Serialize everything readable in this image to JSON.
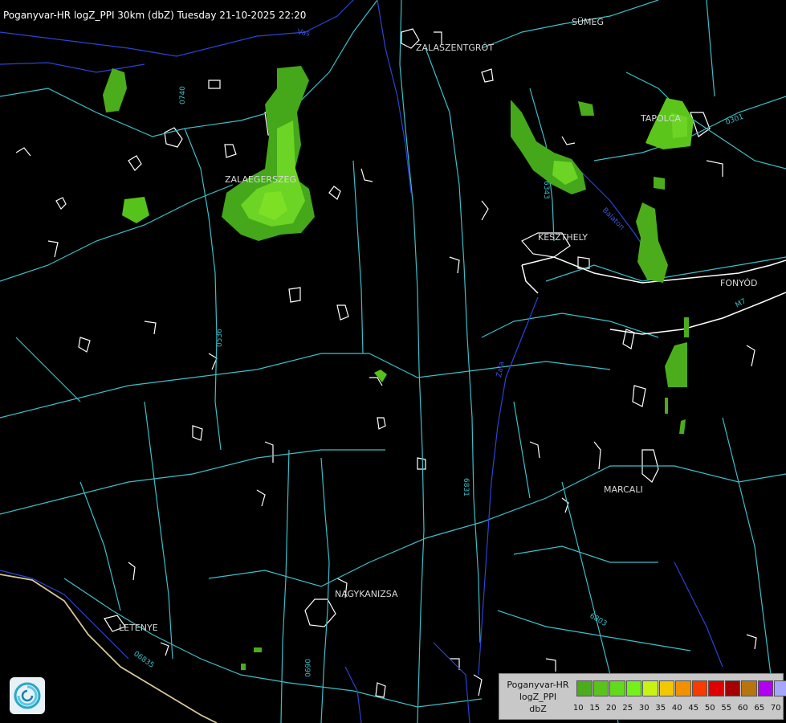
{
  "title": "Poganyvar-HR logZ_PPI 30km (dbZ) Tuesday 21-10-2025 22:20",
  "places": [
    {
      "name": "SÜMEG"
    },
    {
      "name": "ZALASZENTGRÓT"
    },
    {
      "name": "TAPOLCA"
    },
    {
      "name": "ZALAEGERSZEG"
    },
    {
      "name": "KESZTHELY"
    },
    {
      "name": "FONYÓD"
    },
    {
      "name": "MARCALI"
    },
    {
      "name": "NAGYKANIZSA"
    },
    {
      "name": "LETENYE"
    }
  ],
  "road_labels": [
    "0740",
    "0536",
    "6343",
    "6831",
    "6803",
    "06835",
    "0690",
    "0301",
    "M7"
  ],
  "river_labels": [
    "Zala",
    "Balaton",
    "Vas"
  ],
  "legend": {
    "line1": "Poganyvar-HR",
    "line2": "logZ_PPI",
    "line3": "dbZ",
    "ticks": [
      "10",
      "15",
      "20",
      "25",
      "30",
      "35",
      "40",
      "45",
      "50",
      "55",
      "60",
      "65",
      "70"
    ],
    "colors": [
      "#4cad1c",
      "#58c31b",
      "#62d91c",
      "#74f01a",
      "#c8f214",
      "#f1c800",
      "#f29100",
      "#f63a00",
      "#e00000",
      "#a50000",
      "#b8740e",
      "#b000f2",
      "#a6a6ff"
    ]
  },
  "colors": {
    "background": "#000000",
    "roads": "#3cbfc8",
    "rivers": "#2b44d6",
    "borders": "#ffffff",
    "echo_light": "#7ee025",
    "echo_dark": "#44a81a"
  }
}
